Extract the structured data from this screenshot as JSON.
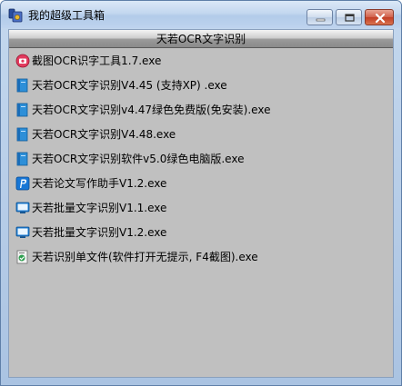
{
  "window": {
    "title": "我的超级工具箱"
  },
  "header": {
    "title": "天若OCR文字识别"
  },
  "items": [
    {
      "label": "截图OCR识字工具1.7.exe",
      "icon": "red-circle-camera-icon"
    },
    {
      "label": "天若OCR文字识别V4.45 (支持XP) .exe",
      "icon": "blue-document-icon"
    },
    {
      "label": "天若OCR文字识别v4.47绿色免费版(免安装).exe",
      "icon": "blue-document-icon"
    },
    {
      "label": "天若OCR文字识别V4.48.exe",
      "icon": "blue-document-icon"
    },
    {
      "label": "天若OCR文字识别软件v5.0绿色电脑版.exe",
      "icon": "blue-document-icon"
    },
    {
      "label": "天若论文写作助手V1.2.exe",
      "icon": "blue-p-icon"
    },
    {
      "label": "天若批量文字识别V1.1.exe",
      "icon": "monitor-icon"
    },
    {
      "label": "天若批量文字识别V1.2.exe",
      "icon": "monitor-icon"
    },
    {
      "label": "天若识别单文件(软件打开无提示, F4截图).exe",
      "icon": "green-scan-icon"
    }
  ]
}
